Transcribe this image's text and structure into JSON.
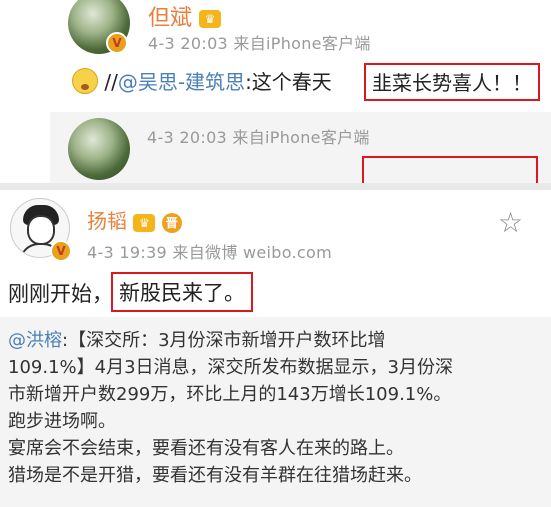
{
  "post1": {
    "user": "但斌",
    "badge_text": "V",
    "crown_text": "♛",
    "meta": "4-3 20:03  来自iPhone客户端",
    "separator": "//",
    "mention": "@吴思-建筑思",
    "text": ":这个春天",
    "highlight": "韭菜长势喜人！！",
    "quoted_meta": "4-3 20:03  来自iPhone客户端"
  },
  "post2": {
    "user": "扬韬",
    "crown_text": "♛",
    "medal_text": "晋",
    "badge_text": "V",
    "meta": "4-3 19:39  来自微博 weibo.com",
    "text": "刚刚开始，",
    "highlight": "新股民来了。",
    "star_icon": "☆",
    "retweet": {
      "mention": "@洪榕",
      "line1_rest": ":【深交所：3月份深市新增开户数环比增",
      "line2": "109.1%】4月3日消息，深交所发布数据显示，3月份深",
      "line3": "市新增开户数299万，环比上月的143万增长109.1%。",
      "line4": "跑步进场啊。",
      "line5": "宴席会不会结束，要看还有没有客人在来的路上。",
      "line6": "猎场是不是开猎，要看还有没有羊群在往猎场赶来。"
    }
  },
  "colors": {
    "username": "#e8803c",
    "link": "#4a7fb8",
    "highlight_border": "#d9191b",
    "meta": "#999999"
  }
}
